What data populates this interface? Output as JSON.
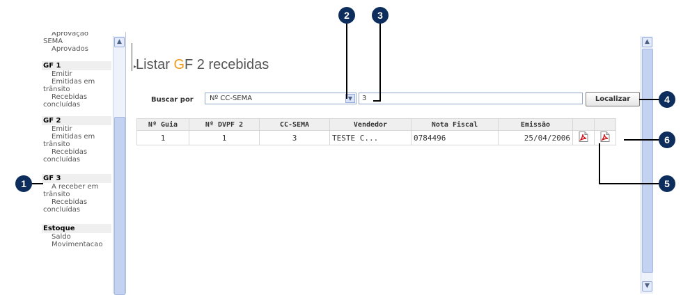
{
  "sidebar": {
    "top_items": [
      "Aprovação",
      "SEMA",
      "Aprovados"
    ],
    "gf1": {
      "title": "GF 1",
      "emitir": "Emitir",
      "em_transito_1": "Emitidas em",
      "em_transito_2": "trânsito",
      "recebidas_1": "Recebidas",
      "recebidas_2": "concluídas"
    },
    "gf2": {
      "title": "GF 2",
      "emitir": "Emitir",
      "em_transito_1": "Emitidas em",
      "em_transito_2": "trânsito",
      "recebidas_1": "Recebidas",
      "recebidas_2": "concluídas"
    },
    "gf3": {
      "title": "GF 3",
      "a_receber_1": "A receber em",
      "a_receber_2": "trânsito",
      "recebidas_1": "Recebidas",
      "recebidas_2": "concluídas"
    },
    "estoque": {
      "title": "Estoque",
      "saldo": "Saldo",
      "movimentacao": "Movimentacao"
    }
  },
  "page": {
    "title_prefix": "Listar ",
    "title_accent": "G",
    "title_rest": "F 2 recebidas",
    "accent_color": "#f19a1a"
  },
  "search": {
    "label": "Buscar por",
    "selected_option": "Nº CC-SEMA",
    "input_value": "3",
    "button_label": "Localizar"
  },
  "table": {
    "headers": [
      "Nº Guia",
      "Nº DVPF 2",
      "CC-SEMA",
      "Vendedor",
      "Nota Fiscal",
      "Emissão"
    ],
    "rows": [
      {
        "guia": "1",
        "dvpf": "1",
        "cc_sema": "3",
        "vendedor": "TESTE C...",
        "nota_fiscal": "0784496",
        "emissao": "25/04/2006",
        "icons": [
          "pdf-icon",
          "pdf-icon"
        ]
      }
    ]
  },
  "callouts": [
    "1",
    "2",
    "3",
    "4",
    "5",
    "6"
  ],
  "colors": {
    "callout_bg": "#0d2d5c",
    "scrollbar": "#c4d2f2"
  }
}
